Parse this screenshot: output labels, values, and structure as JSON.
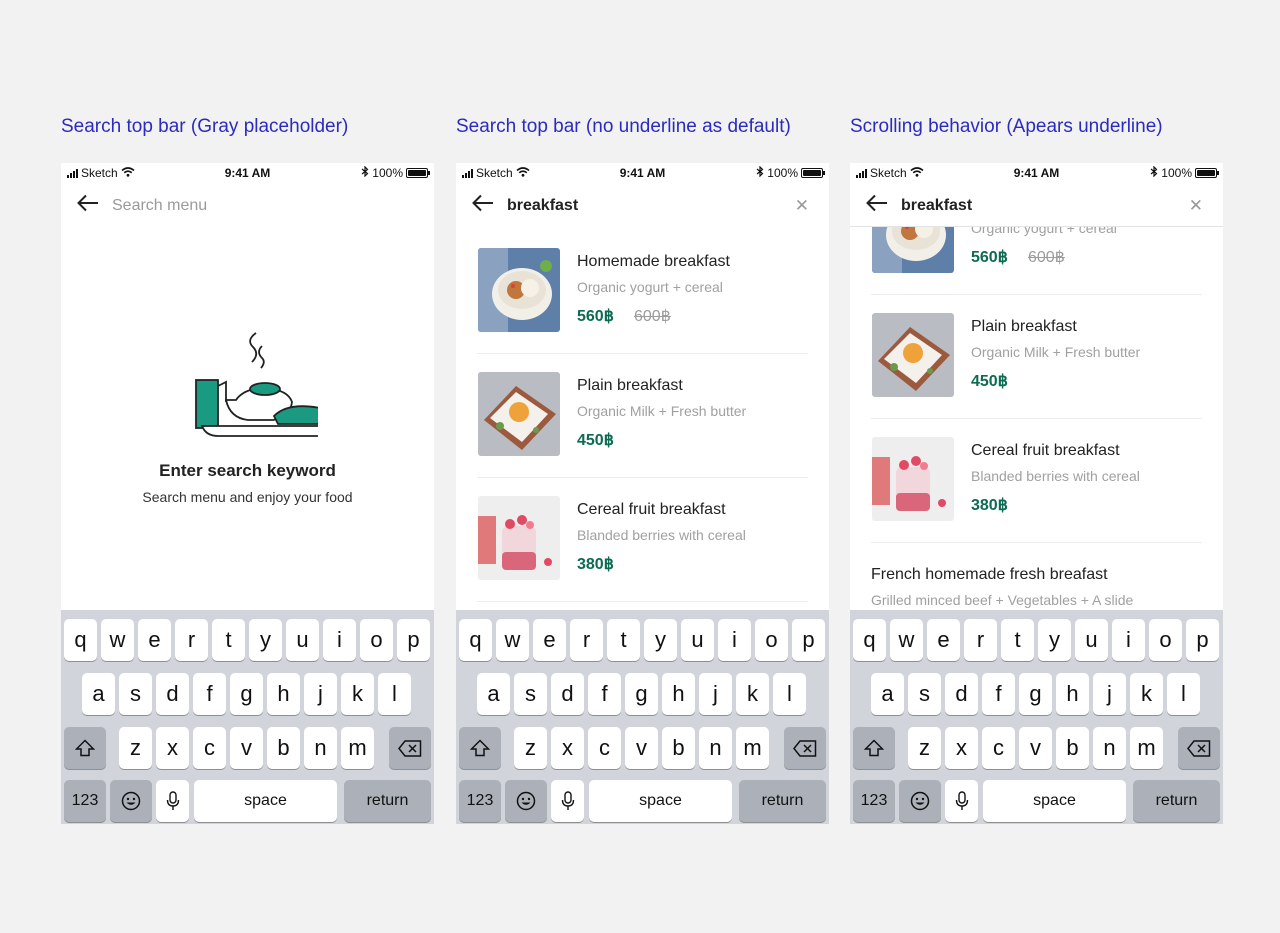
{
  "captions": [
    {
      "title": "Search top bar",
      "note": "(Gray placeholder)"
    },
    {
      "title": "Search top bar",
      "note": "(no underline as default)"
    },
    {
      "title": "Scrolling behavior",
      "note": "(Apears underline)"
    }
  ],
  "status": {
    "carrier": "Sketch",
    "time": "9:41 AM",
    "battery": "100%"
  },
  "screen1": {
    "search_placeholder": "Search menu",
    "empty_title": "Enter search keyword",
    "empty_subtitle": "Search menu and enjoy your food"
  },
  "query": "breakfast",
  "items": [
    {
      "name": "Homemade breakfast",
      "desc": "Organic yogurt + cereal",
      "price": "560฿",
      "old_price": "600฿"
    },
    {
      "name": "Plain breakfast",
      "desc": "Organic Milk + Fresh butter",
      "price": "450฿"
    },
    {
      "name": "Cereal fruit breakfast",
      "desc": "Blanded berries with cereal",
      "price": "380฿"
    },
    {
      "name": "French homemade fresh breafast",
      "desc": "Grilled minced beef + Vegetables + A slide"
    }
  ],
  "keyboard": {
    "row1": [
      "q",
      "w",
      "e",
      "r",
      "t",
      "y",
      "u",
      "i",
      "o",
      "p"
    ],
    "row2": [
      "a",
      "s",
      "d",
      "f",
      "g",
      "h",
      "j",
      "k",
      "l"
    ],
    "row3": [
      "z",
      "x",
      "c",
      "v",
      "b",
      "n",
      "m"
    ],
    "numbers": "123",
    "space": "space",
    "return": "return"
  },
  "colors": {
    "caption": "#2b2bbf",
    "price": "#0d6b53",
    "illustration_accent": "#1a9a80"
  },
  "icons": [
    "back-arrow-icon",
    "close-icon",
    "wifi-icon",
    "bluetooth-icon",
    "battery-icon",
    "shift-icon",
    "delete-icon",
    "emoji-icon",
    "microphone-icon"
  ]
}
